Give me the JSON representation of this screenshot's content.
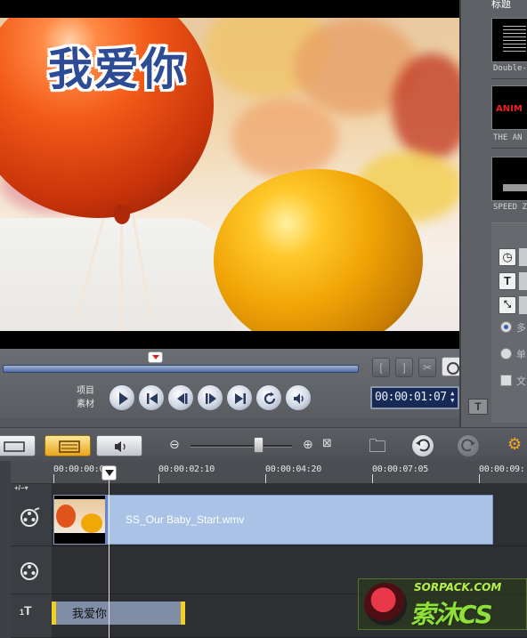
{
  "preview": {
    "overlay_title": "我爱你"
  },
  "transport": {
    "mode_project": "项目",
    "mode_clip": "素材",
    "timecode": "00:00:01:07",
    "trim_in_label": "[",
    "trim_out_label": "]"
  },
  "right_panel": {
    "title": "标题",
    "thumbs": [
      {
        "label": "Double-"
      },
      {
        "label": "THE AN"
      },
      {
        "label": "SPEED Z"
      }
    ],
    "option_texts": [
      "多",
      "单",
      "文"
    ],
    "t_button": "T"
  },
  "ruler": {
    "ticks": [
      "00:00:00:00",
      "00:00:02:10",
      "00:00:04:20",
      "00:00:07:05",
      "00:00:09:"
    ]
  },
  "tracks": {
    "add_label": "+/−▾",
    "video_clip_name": "SS_Our Baby_Start.wmv",
    "title_clip_text": "我爱你",
    "title_track_num": "1"
  },
  "watermark": {
    "url": "SORPACK.COM",
    "brand": "索沐CS"
  },
  "colors": {
    "timecode_bg": "#162a55",
    "video_clip": "#a9c2e6",
    "title_clip_border": "#f0d020",
    "scrub_bar": "#4f6aa3"
  }
}
